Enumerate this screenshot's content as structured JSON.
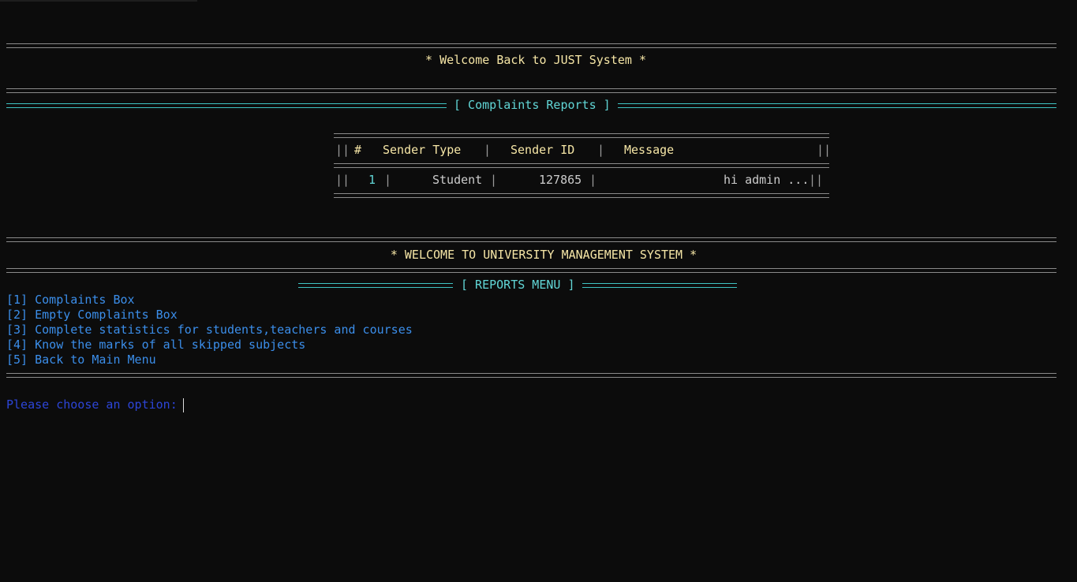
{
  "welcome_back": "* Welcome Back to JUST System *",
  "complaints_title": "[ Complaints Reports ]",
  "table": {
    "headers": [
      "#",
      "Sender Type",
      "Sender ID",
      "Message"
    ],
    "rows": [
      {
        "num": "1",
        "sender_type": "Student",
        "sender_id": "127865",
        "message": "hi admin ..."
      }
    ]
  },
  "welcome_ums": "* WELCOME TO UNIVERSITY MANAGEMENT SYSTEM *",
  "menu_title": "[ REPORTS MENU ]",
  "menu_items": [
    "[1] Complaints Box",
    "[2] Empty Complaints Box",
    "[3] Complete statistics for students,teachers and courses",
    "[4] Know the marks of all skipped subjects",
    "[5] Back to Main Menu"
  ],
  "prompt": "Please choose an option: ",
  "colors": {
    "background": "#0c0c0c",
    "yellow": "#f6e6a6",
    "cyan": "#61d6d6",
    "blue": "#3b8eea",
    "prompt_blue": "#2c45d8"
  }
}
